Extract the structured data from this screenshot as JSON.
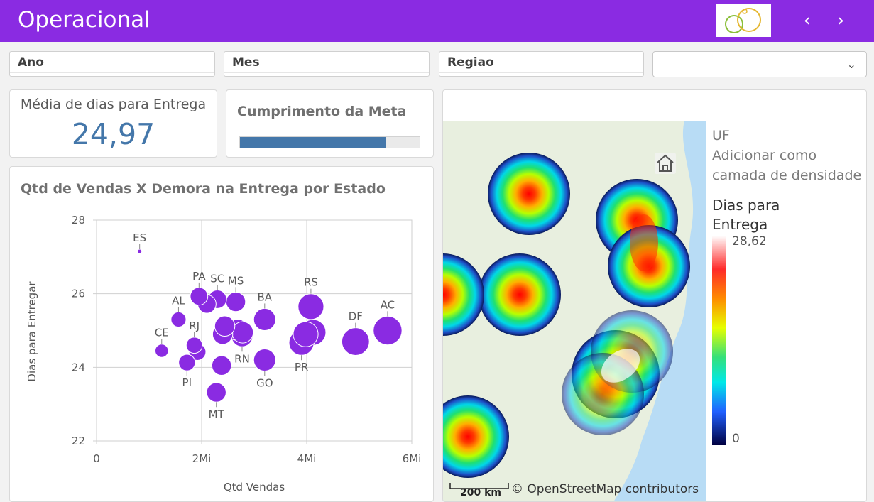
{
  "app": {
    "title": "Operacional"
  },
  "nav": {
    "prev": "‹",
    "next": "›"
  },
  "filters": [
    "Ano",
    "Mes",
    "Regiao"
  ],
  "dropdown": {
    "value": ""
  },
  "kpi": {
    "label": "Média de dias para Entrega",
    "value": "24,97"
  },
  "meta": {
    "title": "Cumprimento da Meta",
    "progress": 0.81
  },
  "chart": {
    "title": "Qtd de Vendas X Demora na Entrega por Estado",
    "xlabel": "Qtd Vendas",
    "ylabel": "Dias para Entregar",
    "xticks": [
      "0",
      "2Mi",
      "4Mi",
      "6Mi"
    ],
    "yticks": [
      "28",
      "26",
      "24",
      "22"
    ]
  },
  "chart_data": {
    "type": "scatter",
    "title": "Qtd de Vendas X Demora na Entrega por Estado",
    "xlabel": "Qtd Vendas",
    "ylabel": "Dias para Entregar",
    "xlim": [
      0,
      6000000
    ],
    "ylim": [
      22,
      28
    ],
    "grid": true,
    "points": [
      {
        "label": "ES",
        "x": 820000,
        "y": 27.15,
        "size": 0.04,
        "labelpos": "above"
      },
      {
        "label": "PA",
        "x": 1950000,
        "y": 25.93,
        "size": 0.4,
        "labelpos": "above"
      },
      {
        "label": "SC",
        "x": 2300000,
        "y": 25.85,
        "size": 0.42,
        "labelpos": "above"
      },
      {
        "label": "MS",
        "x": 2650000,
        "y": 25.78,
        "size": 0.45,
        "labelpos": "above"
      },
      {
        "label": "AL",
        "x": 1560000,
        "y": 25.3,
        "size": 0.33,
        "labelpos": "above"
      },
      {
        "label": "BA",
        "x": 3200000,
        "y": 25.3,
        "size": 0.52,
        "labelpos": "above"
      },
      {
        "label": "RS",
        "x": 4080000,
        "y": 25.65,
        "size": 0.62,
        "labelpos": "above"
      },
      {
        "label": "DF",
        "x": 4930000,
        "y": 24.7,
        "size": 0.67,
        "labelpos": "above"
      },
      {
        "label": "AC",
        "x": 5540000,
        "y": 25.0,
        "size": 0.7,
        "labelpos": "above"
      },
      {
        "label": "CE",
        "x": 1240000,
        "y": 24.45,
        "size": 0.28,
        "labelpos": "above"
      },
      {
        "label": "RJ",
        "x": 1860000,
        "y": 24.6,
        "size": 0.36,
        "labelpos": "above"
      },
      {
        "label": "PI",
        "x": 1720000,
        "y": 24.13,
        "size": 0.37,
        "labelpos": "below"
      },
      {
        "label": "MT",
        "x": 2280000,
        "y": 23.32,
        "size": 0.45,
        "labelpos": "below"
      },
      {
        "label": "RN",
        "x": 2770000,
        "y": 24.85,
        "size": 0.5,
        "labelpos": "below"
      },
      {
        "label": "GO",
        "x": 3200000,
        "y": 24.2,
        "size": 0.52,
        "labelpos": "below"
      },
      {
        "label": "PR",
        "x": 3900000,
        "y": 24.67,
        "size": 0.6,
        "labelpos": "below"
      },
      {
        "label": "",
        "x": 2100000,
        "y": 25.72,
        "size": 0.42
      },
      {
        "label": "",
        "x": 1920000,
        "y": 24.42,
        "size": 0.38
      },
      {
        "label": "",
        "x": 2400000,
        "y": 24.9,
        "size": 0.47
      },
      {
        "label": "",
        "x": 2440000,
        "y": 25.12,
        "size": 0.47
      },
      {
        "label": "",
        "x": 2680000,
        "y": 25.02,
        "size": 0.5
      },
      {
        "label": "",
        "x": 2780000,
        "y": 24.95,
        "size": 0.5
      },
      {
        "label": "",
        "x": 2380000,
        "y": 24.05,
        "size": 0.45
      },
      {
        "label": "",
        "x": 3980000,
        "y": 24.9,
        "size": 0.6
      },
      {
        "label": "",
        "x": 4120000,
        "y": 24.95,
        "size": 0.62
      }
    ],
    "color": "#8a2be2"
  },
  "map": {
    "scale": "200 km",
    "attribution": "© OpenStreetMap contributors",
    "legend": {
      "layer": "UF",
      "density_line1": "Adicionar como",
      "density_line2": "camada de densidade",
      "measure_line1": "Dias para",
      "measure_line2": "Entrega",
      "max": "28,62",
      "min": "0"
    }
  }
}
